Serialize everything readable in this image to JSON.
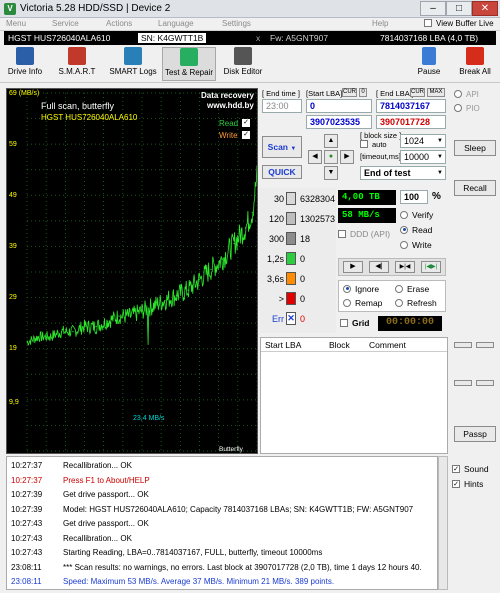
{
  "window": {
    "title": "Victoria 5.28 HDD/SSD | Device 2",
    "icon_label": "V",
    "controls": [
      "minimize-icon",
      "maximize-icon",
      "close-icon"
    ],
    "control_glyphs": [
      "–",
      "□",
      "✕"
    ]
  },
  "menu": {
    "items": [
      "Menu",
      "Service",
      "Actions",
      "Language",
      "Settings",
      "Help"
    ],
    "view_buffer_label": "View Buffer Live"
  },
  "infobar": {
    "model": "HGST HUS726040ALA610",
    "serial": "SN: K4GWTT1B",
    "firmware": "Fw: A5GNT907",
    "capacity": "7814037168 LBA (4,0 TB)",
    "close_glyph": "x"
  },
  "toolbar": {
    "buttons": [
      {
        "label": "Drive Info",
        "icon": "drive-info-icon",
        "color": "#2b5fa8"
      },
      {
        "label": "S.M.A.R.T",
        "icon": "smart-icon",
        "color": "#c0392b"
      },
      {
        "label": "SMART Logs",
        "icon": "smart-logs-icon",
        "color": "#2980b9"
      },
      {
        "label": "Test & Repair",
        "icon": "test-repair-icon",
        "color": "#27ae60"
      },
      {
        "label": "Disk Editor",
        "icon": "disk-editor-icon",
        "color": "#555"
      }
    ],
    "pause_label": "Pause",
    "break_label": "Break All"
  },
  "graph": {
    "y_unit": "69 (MB/s)",
    "y_ticks": [
      "59",
      "49",
      "39",
      "29",
      "19",
      "9,9"
    ],
    "title": "Full scan, butterfly",
    "drive": "HGST HUS726040ALA610",
    "watermark_1": "Data recovery",
    "watermark_2": "www.hdd.by",
    "read_label": "Read",
    "write_label": "Write",
    "check_glyph": "✓",
    "current_speed": "23,4 MB/s",
    "footer": "Butterfly scan"
  },
  "chart_data": {
    "type": "line",
    "title": "Full scan, butterfly",
    "ylabel": "(MB/s)",
    "ylim": [
      0,
      69
    ],
    "x": [
      0,
      5,
      10,
      15,
      20,
      25,
      30,
      35,
      40,
      45,
      50,
      55,
      60,
      65,
      70,
      75,
      80,
      85,
      90,
      95,
      98,
      100
    ],
    "series": [
      {
        "name": "Read",
        "values": [
          21,
          22,
          22,
          23,
          23,
          24,
          24,
          25,
          26,
          26,
          27,
          28,
          29,
          30,
          31,
          33,
          35,
          37,
          40,
          43,
          46,
          53
        ]
      }
    ]
  },
  "lba": {
    "end_time_label": "[ End time ]",
    "start_lba_label": "[Start LBA]",
    "cur_label": "CUR",
    "zero_label": "0",
    "end_lba_label": "[ End LBA ]",
    "max_label": "MAX",
    "end_time": "23:00",
    "start_lba": "0",
    "end_lba": "7814037167",
    "current_start": "3907023535",
    "current_end": "3907017728",
    "block_size_label": "[ block size ]",
    "auto_label": "auto",
    "timeout_label": "[timeout,ms]",
    "block_size": "1024",
    "timeout": "10000",
    "dropdown_glyph": "▼",
    "end_action": "End of test"
  },
  "controls": {
    "scan_label": "Scan",
    "quick_label": "QUICK",
    "grid_label": "Grid",
    "grid_time": "00:00:00",
    "ddd_label": "DDD (API)",
    "arrow_glyphs": [
      "▲",
      "◀",
      "●",
      "▶",
      "▼"
    ]
  },
  "counters": [
    {
      "label": "30",
      "value": "6328304",
      "color": "#d8d8d8"
    },
    {
      "label": "120",
      "value": "1302573",
      "color": "#bdbdbd"
    },
    {
      "label": "300",
      "value": "18",
      "color": "#8c8c8c"
    },
    {
      "label": "1,2s",
      "value": "0",
      "color": "#2ecc40"
    },
    {
      "label": "3,6s",
      "value": "0",
      "color": "#ff8c00"
    },
    {
      "label": ">",
      "value": "0",
      "color": "#e00000"
    },
    {
      "label": "Err",
      "value": "0",
      "color": "#1a3bd1"
    }
  ],
  "counter_err_glyph": "✕",
  "progress": {
    "size": "4,00 TB",
    "percent": "100",
    "percent_sign": "%",
    "speed": "58 MB/s"
  },
  "mode": {
    "options": [
      "Verify",
      "Read",
      "Write"
    ],
    "selected": "Read"
  },
  "transport": {
    "glyphs": [
      "▶",
      "◀|",
      "▶|◀",
      "|◀▶|"
    ]
  },
  "repair": {
    "options": [
      "Ignore",
      "Erase",
      "Remap",
      "Refresh"
    ],
    "selected": "Ignore"
  },
  "table": {
    "headers": [
      "Start LBA",
      "Block",
      "Comment"
    ]
  },
  "right": {
    "api_label": "API",
    "pio_label": "PIO",
    "sleep_label": "Sleep",
    "recall_label": "Recall",
    "passp_label": "Passp"
  },
  "log": [
    {
      "time": "10:27:37",
      "msg": "Recallibration... OK",
      "color": "#000"
    },
    {
      "time": "10:27:37",
      "msg": "Press F1 to About/HELP",
      "color": "#cc0000"
    },
    {
      "time": "10:27:39",
      "msg": "Get drive passport... OK",
      "color": "#000"
    },
    {
      "time": "10:27:39",
      "msg": "Model: HGST HUS726040ALA610; Capacity 7814037168 LBAs; SN: K4GWTT1B; FW: A5GNT907",
      "color": "#000"
    },
    {
      "time": "10:27:43",
      "msg": "Get drive passport... OK",
      "color": "#000"
    },
    {
      "time": "10:27:43",
      "msg": "Recallibration... OK",
      "color": "#000"
    },
    {
      "time": "10:27:43",
      "msg": "Starting Reading, LBA=0..7814037167, FULL, butterfly, timeout 10000ms",
      "color": "#000"
    },
    {
      "time": "23:08:11",
      "msg": "*** Scan results: no warnings, no errors. Last block at 3907017728 (2,0 TB), time 1 days 12 hours 40.",
      "color": "#000"
    },
    {
      "time": "23:08:11",
      "msg": "Speed: Maximum 53 MB/s. Average 37 MB/s. Minimum 21 MB/s. 389 points.",
      "color": "#1a3bd1"
    }
  ],
  "log_options": {
    "sound_label": "Sound",
    "hints_label": "Hints"
  }
}
